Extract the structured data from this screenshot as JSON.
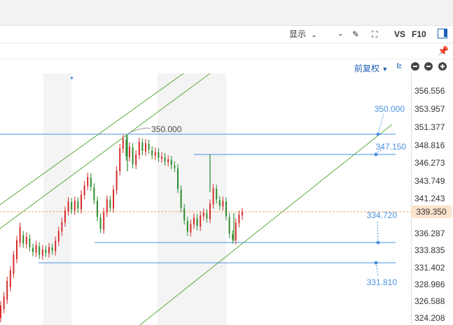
{
  "toolbar": {
    "display_label": "显示",
    "vs_label": "VS",
    "f10_label": "F10"
  },
  "mode": {
    "adjust_label": "前复权"
  },
  "chart_data": {
    "type": "candlestick",
    "y_ticks": [
      "356.556",
      "353.957",
      "351.377",
      "348.816",
      "346.273",
      "343.749",
      "341.243",
      "339.350",
      "336.287",
      "333.835",
      "331.402",
      "328.986",
      "326.588",
      "324.208"
    ],
    "current_price": "339.350",
    "annotations": [
      {
        "label": "350.000",
        "kind": "peak"
      },
      {
        "label": "350.000",
        "kind": "level"
      },
      {
        "label": "347.150",
        "kind": "level"
      },
      {
        "label": "334.720",
        "kind": "level"
      },
      {
        "label": "331.810",
        "kind": "level"
      }
    ],
    "candles": [
      [
        0,
        324.2,
        326.0
      ],
      [
        2,
        325.5,
        327.3
      ],
      [
        4,
        326.8,
        329.5
      ],
      [
        6,
        328.6,
        331.0
      ],
      [
        8,
        330.5,
        333.2
      ],
      [
        10,
        332.6,
        335.3
      ],
      [
        12,
        334.9,
        337.2
      ],
      [
        14,
        336.0,
        334.8
      ],
      [
        16,
        334.7,
        335.8
      ],
      [
        18,
        335.5,
        334.3
      ],
      [
        20,
        334.2,
        333.6
      ],
      [
        22,
        333.5,
        334.6
      ],
      [
        24,
        334.4,
        333.2
      ],
      [
        26,
        333.1,
        334.0
      ],
      [
        28,
        333.9,
        333.5
      ],
      [
        30,
        333.4,
        334.3
      ],
      [
        32,
        334.2,
        333.8
      ],
      [
        34,
        333.7,
        335.2
      ],
      [
        36,
        335.1,
        336.6
      ],
      [
        38,
        336.5,
        337.9
      ],
      [
        40,
        337.8,
        339.5
      ],
      [
        42,
        339.4,
        340.8
      ],
      [
        44,
        340.7,
        339.6
      ],
      [
        46,
        339.5,
        340.9
      ],
      [
        48,
        340.8,
        339.8
      ],
      [
        50,
        339.7,
        341.8
      ],
      [
        52,
        341.7,
        343.1
      ],
      [
        54,
        343.0,
        344.3
      ],
      [
        56,
        344.2,
        342.9
      ],
      [
        58,
        342.8,
        341.0
      ],
      [
        60,
        340.9,
        338.6
      ],
      [
        62,
        338.5,
        336.9
      ],
      [
        64,
        336.8,
        339.3
      ],
      [
        66,
        339.2,
        341.1
      ],
      [
        68,
        341.0,
        339.9
      ],
      [
        70,
        339.8,
        342.5
      ],
      [
        72,
        342.4,
        345.2
      ],
      [
        74,
        345.1,
        348.4
      ],
      [
        76,
        348.3,
        349.7
      ],
      [
        78,
        349.6,
        347.2
      ],
      [
        80,
        347.1,
        348.6
      ],
      [
        82,
        348.5,
        346.1
      ],
      [
        84,
        346.0,
        347.5
      ],
      [
        86,
        347.4,
        349.3
      ],
      [
        88,
        349.2,
        348.0
      ],
      [
        90,
        347.9,
        349.1
      ],
      [
        92,
        349.0,
        348.2
      ],
      [
        94,
        348.1,
        347.4
      ],
      [
        96,
        347.3,
        347.9
      ],
      [
        98,
        347.8,
        347.0
      ],
      [
        100,
        346.9,
        347.2
      ],
      [
        102,
        347.1,
        346.5
      ],
      [
        104,
        346.4,
        346.8
      ],
      [
        106,
        346.7,
        346.0
      ],
      [
        108,
        345.9,
        345.6
      ],
      [
        110,
        345.5,
        342.6
      ],
      [
        112,
        342.5,
        339.9
      ],
      [
        114,
        339.8,
        338.1
      ],
      [
        116,
        338.0,
        336.5
      ],
      [
        118,
        336.4,
        337.6
      ],
      [
        120,
        337.5,
        338.5
      ],
      [
        122,
        338.4,
        337.3
      ],
      [
        124,
        337.2,
        338.8
      ],
      [
        126,
        338.7,
        339.2
      ],
      [
        128,
        339.1,
        338.4
      ],
      [
        130,
        338.3,
        340.5
      ],
      [
        132,
        340.4,
        342.7
      ],
      [
        134,
        342.6,
        341.1
      ],
      [
        136,
        341.0,
        340.2
      ],
      [
        138,
        340.1,
        340.9
      ],
      [
        140,
        340.8,
        338.7
      ],
      [
        142,
        338.6,
        336.2
      ],
      [
        144,
        336.1,
        335.4
      ],
      [
        146,
        335.3,
        337.8
      ],
      [
        148,
        337.7,
        338.9
      ],
      [
        150,
        338.8,
        339.3
      ]
    ]
  }
}
